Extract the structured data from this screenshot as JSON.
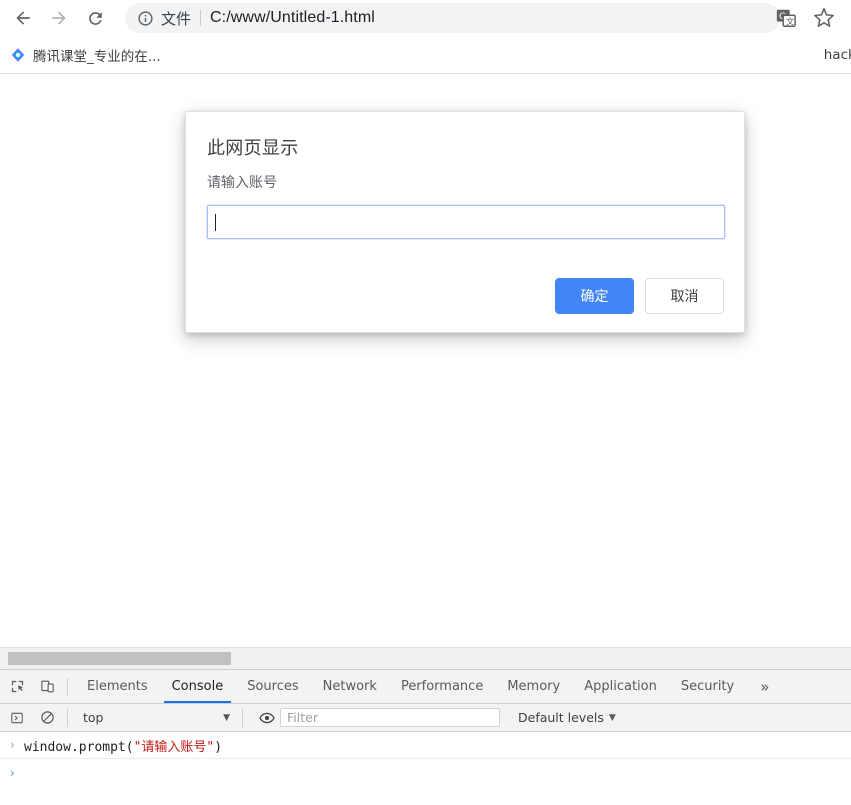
{
  "browser": {
    "nav": {
      "back_label": "Back",
      "forward_label": "Forward",
      "reload_label": "Reload"
    },
    "omnibox": {
      "info_icon": "info-circle-icon",
      "scheme_label": "文件",
      "url": "C:/www/Untitled-1.html"
    },
    "actions": {
      "translate_label": "Translate this page",
      "bookmark_label": "Bookmark this tab"
    },
    "bookmarks": [
      {
        "label": "腾讯课堂_专业的在...",
        "icon": "tencent-ketang-icon"
      },
      {
        "label": "hackin...",
        "icon": "bookmark-icon"
      }
    ]
  },
  "dialog": {
    "title": "此网页显示",
    "message": "请输入账号",
    "input_value": "",
    "confirm_label": "确定",
    "cancel_label": "取消"
  },
  "devtools": {
    "tabs": [
      {
        "label": "Elements",
        "active": false
      },
      {
        "label": "Console",
        "active": true
      },
      {
        "label": "Sources",
        "active": false
      },
      {
        "label": "Network",
        "active": false
      },
      {
        "label": "Performance",
        "active": false
      },
      {
        "label": "Memory",
        "active": false
      },
      {
        "label": "Application",
        "active": false
      },
      {
        "label": "Security",
        "active": false
      }
    ],
    "more_tabs_label": "»",
    "inspect_icon": "inspect-element-icon",
    "device_icon": "device-toolbar-icon",
    "console": {
      "sidebar_icon": "console-sidebar-icon",
      "clear_icon": "clear-console-icon",
      "context": "top",
      "context_caret": "▼",
      "eye_icon": "live-expression-eye-icon",
      "filter_placeholder": "Filter",
      "filter_value": "",
      "levels_label": "Default levels",
      "levels_caret": "▼",
      "entries": [
        {
          "arrow": "›",
          "code_prefix": "window.prompt(",
          "code_string": "\"请输入账号\"",
          "code_suffix": ")"
        }
      ],
      "prompt_arrow": "›"
    }
  },
  "colors": {
    "accent_blue": "#4285f4",
    "devtools_active": "#1a73e8",
    "string_red": "#c41a16"
  }
}
